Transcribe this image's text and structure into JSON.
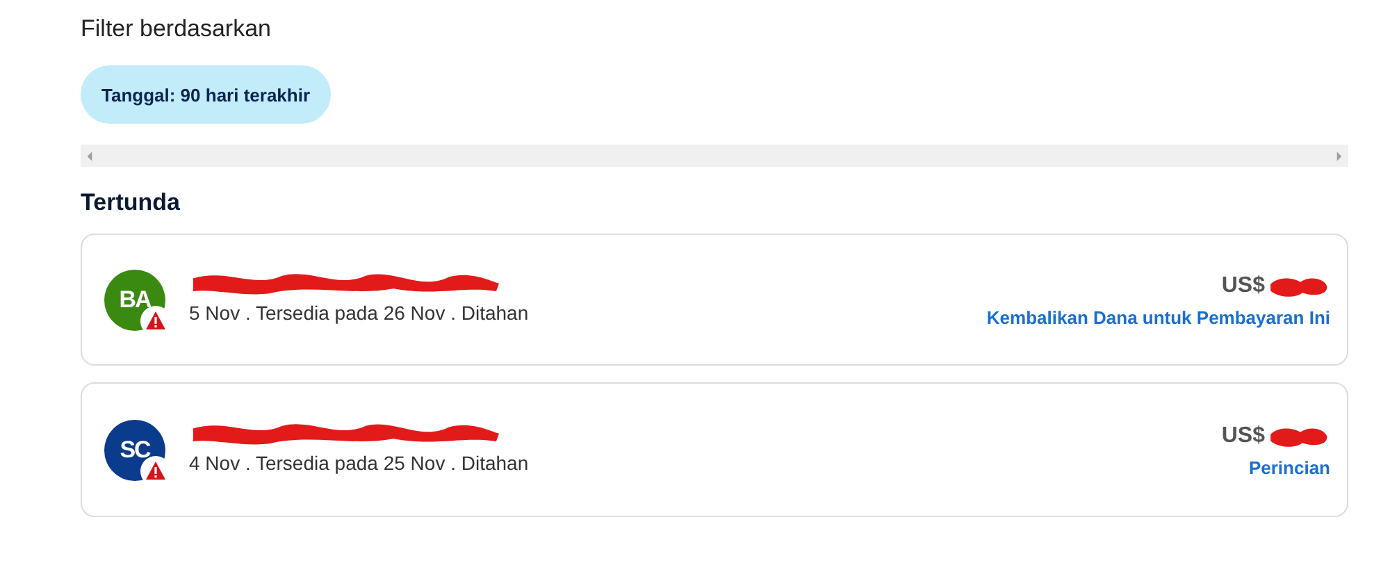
{
  "filter_heading": "Filter berdasarkan",
  "filter_chips": [
    {
      "label": "Tanggal: 90 hari terakhir",
      "selected": true
    }
  ],
  "section_title": "Tertunda",
  "transactions": [
    {
      "initials": "BA",
      "color": "#3a8a12",
      "warning": true,
      "name_redacted": true,
      "details": "5 Nov . Tersedia pada 26 Nov . Ditahan",
      "amount": "US$",
      "amount_redacted": true,
      "action": "Kembalikan Dana untuk Pembayaran Ini"
    },
    {
      "initials": "SC",
      "color": "#0b3b8c",
      "warning": true,
      "name_redacted": true,
      "details": "4 Nov . Tersedia pada 25 Nov . Ditahan",
      "amount": "US$",
      "amount_redacted": true,
      "action": "Perincian"
    }
  ]
}
